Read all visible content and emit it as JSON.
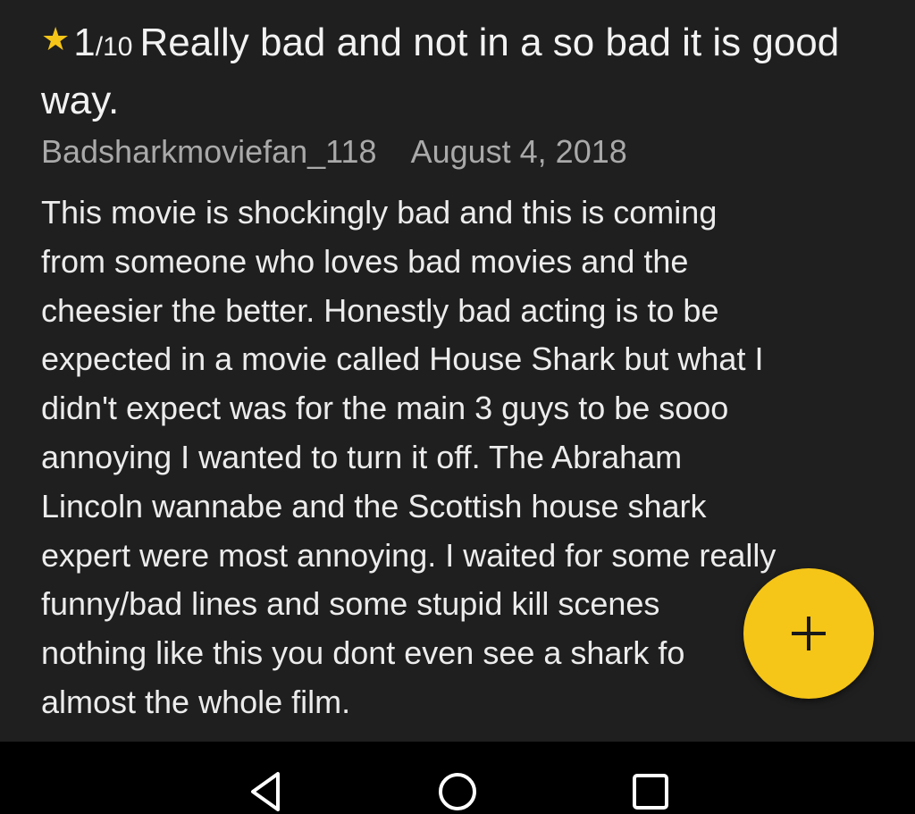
{
  "review": {
    "rating": {
      "value": "1",
      "max": "/10"
    },
    "title": "Really bad and not in a so bad it is good way.",
    "author": "Badsharkmoviefan_118",
    "date": "August 4, 2018",
    "body_lines": [
      "This movie is shockingly bad and this is coming",
      "from someone who loves bad movies and the",
      "cheesier the better. Honestly bad acting is to be",
      "expected in a movie called House Shark but what I",
      "didn't expect was for the main 3 guys to be sooo",
      "annoying I wanted to turn it off. The Abraham",
      "Lincoln wannabe and the Scottish house shark",
      "expert were most annoying. I waited for some really",
      "funny/bad lines and some stupid kill scenes",
      "nothing like this you dont even see a shark fo",
      "almost the whole film."
    ]
  },
  "fab": {
    "icon": "plus-icon",
    "color": "#f5c518"
  },
  "nav": {
    "back_icon": "back-triangle-icon",
    "home_icon": "home-circle-icon",
    "recents_icon": "recents-square-icon"
  },
  "colors": {
    "background": "#1f1f1f",
    "accent": "#f5c518",
    "meta_text": "#a9a9a9",
    "body_text": "#ececec",
    "nav_background": "#000000"
  }
}
